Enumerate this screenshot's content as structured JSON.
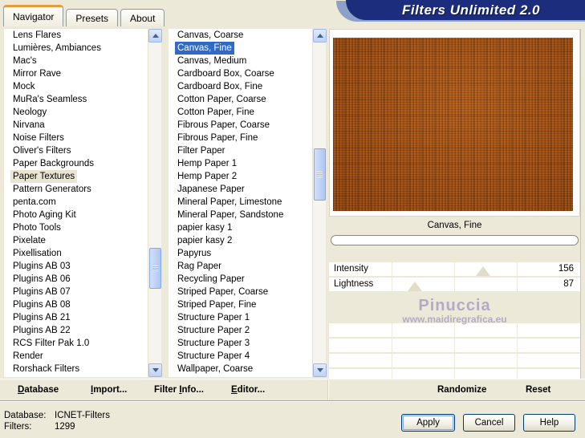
{
  "window": {
    "title": "Filters Unlimited 2.0"
  },
  "tabs": {
    "active_index": 0,
    "items": [
      {
        "label": "Navigator"
      },
      {
        "label": "Presets"
      },
      {
        "label": "About"
      }
    ]
  },
  "category_list": {
    "selected_index": 11,
    "items": [
      "Lens Flares",
      "Lumières, Ambiances",
      "Mac's",
      "Mirror Rave",
      "Mock",
      "MuRa's Seamless",
      "Neology",
      "Nirvana",
      "Noise Filters",
      "Oliver's Filters",
      "Paper Backgrounds",
      "Paper Textures",
      "Pattern Generators",
      "penta.com",
      "Photo Aging Kit",
      "Photo Tools",
      "Pixelate",
      "Pixellisation",
      "Plugins AB 03",
      "Plugins AB 06",
      "Plugins AB 07",
      "Plugins AB 08",
      "Plugins AB 21",
      "Plugins AB 22",
      "RCS Filter Pak 1.0",
      "Render",
      "Rorshack Filters"
    ]
  },
  "filter_list": {
    "selected_index": 1,
    "items": [
      "Canvas, Coarse",
      "Canvas, Fine",
      "Canvas, Medium",
      "Cardboard Box, Coarse",
      "Cardboard Box, Fine",
      "Cotton Paper, Coarse",
      "Cotton Paper, Fine",
      "Fibrous Paper, Coarse",
      "Fibrous Paper, Fine",
      "Filter Paper",
      "Hemp Paper 1",
      "Hemp Paper 2",
      "Japanese Paper",
      "Mineral Paper, Limestone",
      "Mineral Paper, Sandstone",
      "papier kasy 1",
      "papier kasy 2",
      "Papyrus",
      "Rag Paper",
      "Recycling Paper",
      "Striped Paper, Coarse",
      "Striped Paper, Fine",
      "Structure Paper 1",
      "Structure Paper 2",
      "Structure Paper 3",
      "Structure Paper 4",
      "Wallpaper, Coarse"
    ]
  },
  "preview": {
    "caption": "Canvas, Fine"
  },
  "sliders": {
    "max": 255,
    "empty_rows": 5,
    "items": [
      {
        "label": "Intensity",
        "value": 156
      },
      {
        "label": "Lightness",
        "value": 87
      }
    ]
  },
  "watermark": {
    "name": "Pinuccia",
    "url": "www.maidiregrafica.eu"
  },
  "menu": {
    "items": [
      {
        "pre": "",
        "key": "D",
        "post": "atabase"
      },
      {
        "pre": "",
        "key": "I",
        "post": "mport..."
      },
      {
        "pre": "Filter ",
        "key": "I",
        "post": "nfo..."
      },
      {
        "pre": "",
        "key": "E",
        "post": "ditor..."
      }
    ],
    "randomize": "Randomize",
    "reset": "Reset"
  },
  "status": {
    "database_label": "Database:",
    "database_value": "ICNET-Filters",
    "filters_label": "Filters:",
    "filters_value": "1299"
  },
  "actions": {
    "apply": "Apply",
    "cancel": "Cancel",
    "help": "Help"
  },
  "colors": {
    "dialog-bg": "#ece9d8",
    "selection-blue": "#316ac5",
    "selection-inactive": "#e9e5d3",
    "banner-navy": "#1c2d7d",
    "banner-accent": "#8ca0c8",
    "texture-base": "#a9571b",
    "tab-accent-orange": "#e79b3c",
    "watermark-color": "#b3abc6",
    "button-border": "#003c74"
  }
}
